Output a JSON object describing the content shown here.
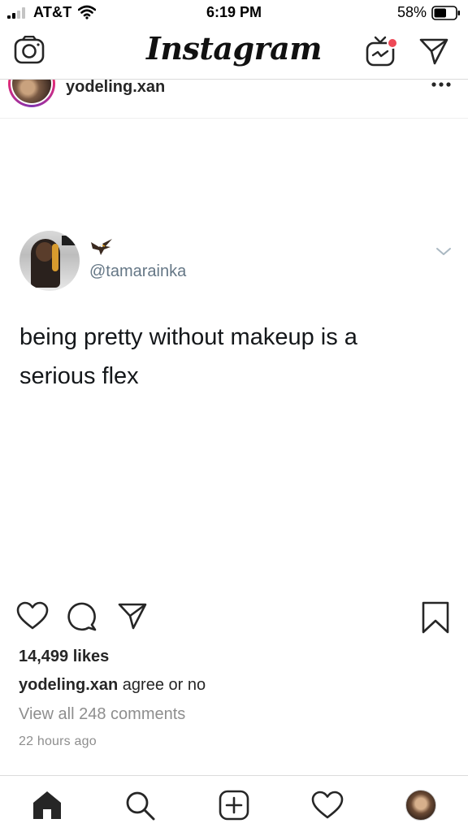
{
  "status_bar": {
    "carrier": "AT&T",
    "time": "6:19 PM",
    "battery_percent": "58%",
    "battery_level": 0.58,
    "icons": [
      "signal-icon",
      "wifi-icon",
      "battery-icon"
    ]
  },
  "top_nav": {
    "logo_text": "Instagram",
    "icons": [
      "camera-icon",
      "igtv-icon",
      "direct-message-icon"
    ],
    "notification_dot_color": "#ed4956"
  },
  "post": {
    "username": "yodeling.xan",
    "more_icon": "more-options-icon",
    "tweet": {
      "handle": "@tamarainka",
      "name_emoji": "eagle-emoji",
      "text": "being pretty without makeup is a serious flex"
    },
    "actions": [
      "heart-icon",
      "comment-icon",
      "share-icon",
      "bookmark-icon"
    ],
    "likes": "14,499 likes",
    "caption": {
      "user": "yodeling.xan",
      "text": " agree or no"
    },
    "view_comments": "View all 248 comments",
    "timestamp": "22 hours ago"
  },
  "tab_bar": {
    "tabs": [
      "home-icon",
      "search-icon",
      "create-post-icon",
      "activity-heart-icon",
      "profile-avatar"
    ]
  },
  "colors": {
    "text_primary": "#262626",
    "text_secondary": "#8e8e8e",
    "tweet_handle": "#657786",
    "divider": "#dbdbdb",
    "story_ring": [
      "#f58529",
      "#dd2a7b",
      "#8134af"
    ]
  }
}
